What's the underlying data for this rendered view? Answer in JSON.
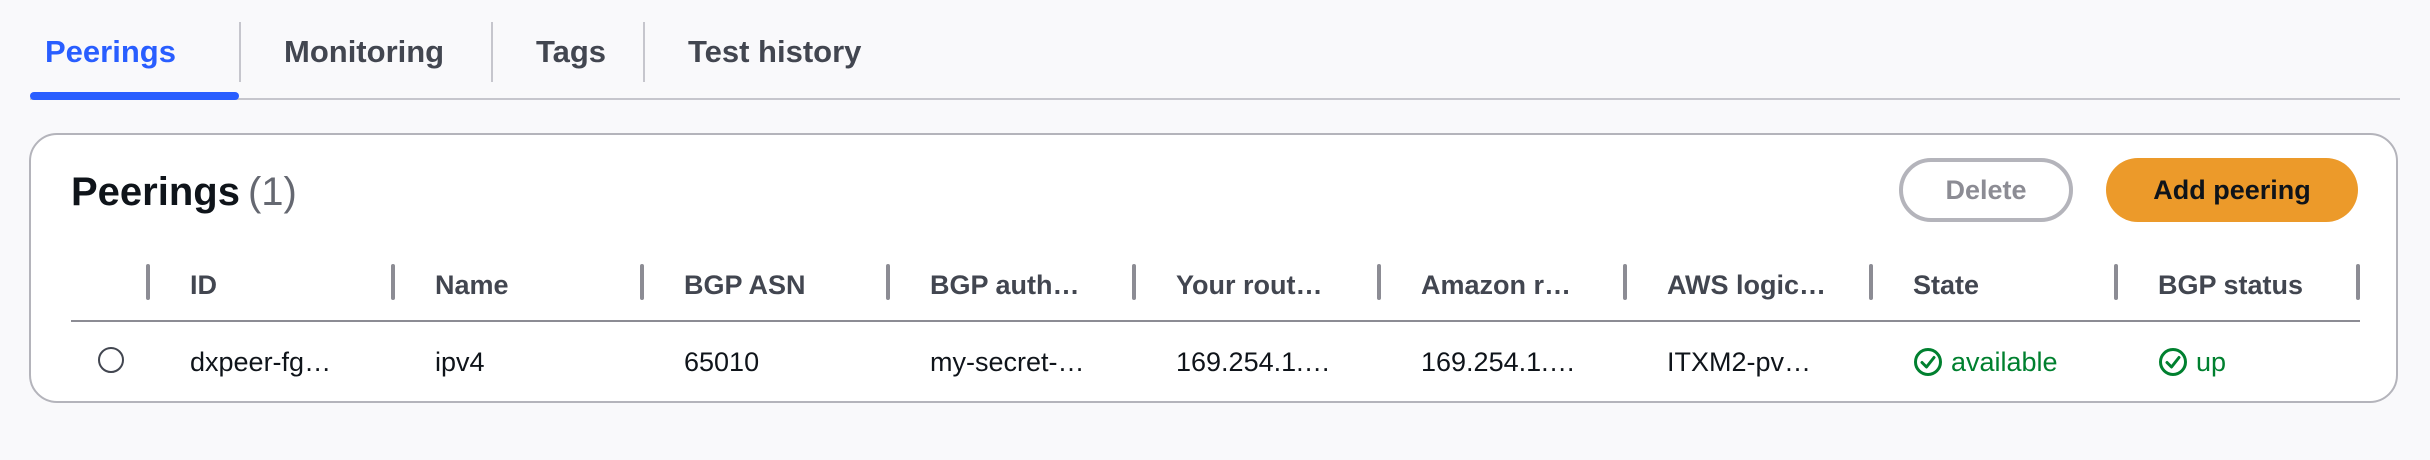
{
  "tabs": [
    {
      "label": "Peerings",
      "active": true
    },
    {
      "label": "Monitoring",
      "active": false
    },
    {
      "label": "Tags",
      "active": false
    },
    {
      "label": "Test history",
      "active": false
    }
  ],
  "peerings": {
    "title": "Peerings",
    "count": "(1)",
    "delete_label": "Delete",
    "add_label": "Add peering",
    "columns": [
      "ID",
      "Name",
      "BGP ASN",
      "BGP auth…",
      "Your rout…",
      "Amazon r…",
      "AWS logic…",
      "State",
      "BGP status"
    ],
    "rows": [
      {
        "selected": false,
        "id": "dxpeer-fg…",
        "name": "ipv4",
        "bgp_asn": "65010",
        "bgp_auth": "my-secret-…",
        "your_router": "169.254.1.…",
        "amazon_router": "169.254.1.…",
        "aws_logical": "ITXM2-pv…",
        "state": "available",
        "bgp_status": "up"
      }
    ]
  },
  "colors": {
    "accent": "#295eff",
    "primary_button": "#ec9a2a",
    "success": "#00802f"
  },
  "icons": {
    "state": "check-circle-icon",
    "bgp_status": "check-circle-icon"
  }
}
